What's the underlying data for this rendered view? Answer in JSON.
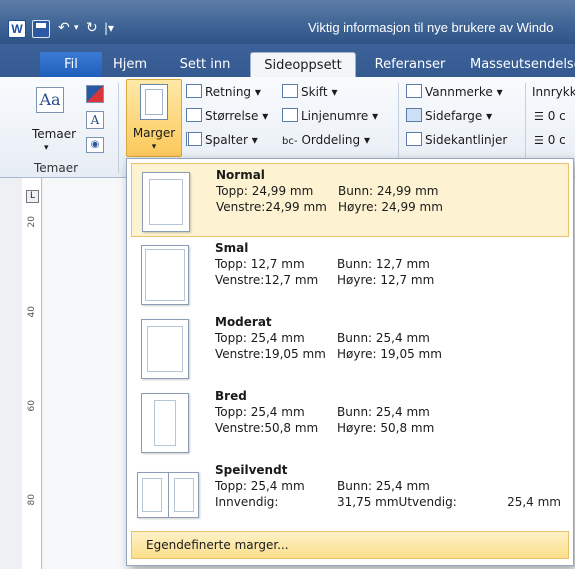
{
  "window": {
    "title": "Viktig informasjon til nye brukere av Windo"
  },
  "quick_access": {
    "word_glyph": "W"
  },
  "tabs": [
    "Fil",
    "Hjem",
    "Sett inn",
    "Sideoppsett",
    "Referanser",
    "Masseutsendelse"
  ],
  "ribbon": {
    "themes": {
      "label": "Temaer",
      "group": "Temaer"
    },
    "marger": {
      "label": "Marger"
    },
    "page_setup": {
      "retning": "Retning",
      "storrelse": "Størrelse",
      "spalter": "Spalter",
      "skift": "Skift",
      "linjenumre": "Linjenumre",
      "orddeling": "Orddeling"
    },
    "background": {
      "vannmerke": "Vannmerke",
      "sidefarge": "Sidefarge",
      "sidekantlinjer": "Sidekantlinjer"
    },
    "indent": {
      "label": "Innrykk",
      "values": [
        "0 c",
        "0 c"
      ]
    }
  },
  "ruler": {
    "numbers": [
      "20",
      "40",
      "60",
      "80"
    ]
  },
  "margins": [
    {
      "name": "Normal",
      "line1a": "Topp:  24,99 mm",
      "line1b": "Bunn:  24,99 mm",
      "line2a": "Venstre:24,99 mm",
      "line2b": "Høyre:  24,99 mm"
    },
    {
      "name": "Smal",
      "line1a": "Topp:  12,7 mm",
      "line1b": "Bunn:  12,7 mm",
      "line2a": "Venstre:12,7 mm",
      "line2b": "Høyre:  12,7 mm"
    },
    {
      "name": "Moderat",
      "line1a": "Topp:  25,4 mm",
      "line1b": "Bunn:  25,4 mm",
      "line2a": "Venstre:19,05 mm",
      "line2b": "Høyre:  19,05 mm"
    },
    {
      "name": "Bred",
      "line1a": "Topp:  25,4 mm",
      "line1b": "Bunn:  25,4 mm",
      "line2a": "Venstre:50,8 mm",
      "line2b": "Høyre:  50,8 mm"
    },
    {
      "name": "Speilvendt",
      "line1a": "Topp:  25,4 mm",
      "line1b": "Bunn:  25,4 mm",
      "line2a": "Innvendig:",
      "line2b": "31,75 mmUtvendig:",
      "line2c": "25,4 mm"
    }
  ],
  "custom_margins": "Egendefinerte marger...",
  "colors": {
    "accent": "#fcc95c",
    "title_bar": "#3f6596"
  }
}
